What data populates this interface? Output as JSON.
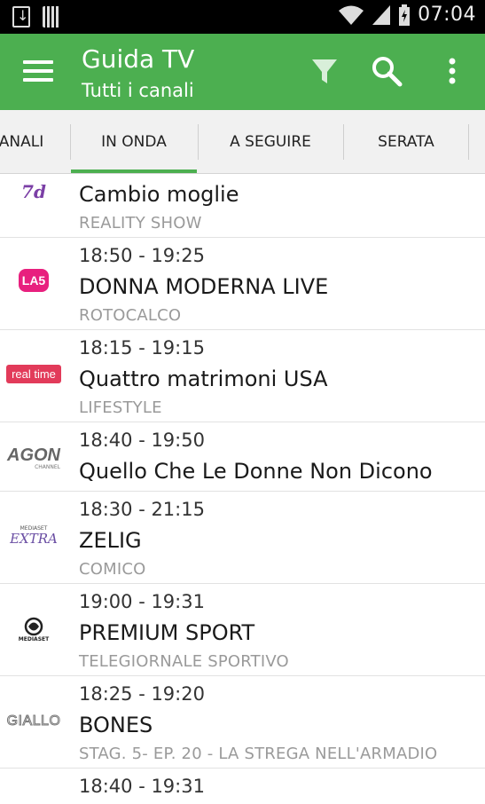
{
  "status_bar": {
    "time": "07:04"
  },
  "app_bar": {
    "title": "Guida TV",
    "subtitle": "Tutti i canali",
    "accent": "#4caf50"
  },
  "tabs": [
    "ANALI",
    "IN ONDA",
    "A SEGUIRE",
    "SERATA"
  ],
  "active_tab": "IN ONDA",
  "programs": [
    {
      "channel_logo": "7d",
      "time": "",
      "title": "Cambio moglie",
      "category": "REALITY SHOW"
    },
    {
      "channel_logo": "LA5",
      "time": "18:50 - 19:25",
      "title": "DONNA MODERNA LIVE",
      "category": "ROTOCALCO"
    },
    {
      "channel_logo": "real time",
      "time": "18:15 - 19:15",
      "title": "Quattro matrimoni USA",
      "category": "LIFESTYLE"
    },
    {
      "channel_logo": "AGON",
      "logo_sub": "CHANNEL",
      "time": "18:40 - 19:50",
      "title": "Quello Che Le Donne Non Dicono",
      "category": ""
    },
    {
      "channel_logo": "EXTRA",
      "logo_sub": "MEDIASET",
      "time": "18:30 - 21:15",
      "title": "ZELIG",
      "category": "COMICO"
    },
    {
      "channel_logo": "PREMIUM",
      "logo_sub": "MEDIASET",
      "time": "19:00 - 19:31",
      "title": "PREMIUM SPORT",
      "category": "TELEGIORNALE SPORTIVO"
    },
    {
      "channel_logo": "GIALLO",
      "time": "18:25 - 19:20",
      "title": "BONES",
      "category": "STAG. 5- EP. 20 - LA STREGA NELL'ARMADIO"
    },
    {
      "channel_logo": "",
      "time": "18:40 - 19:31",
      "title": "",
      "category": ""
    }
  ]
}
